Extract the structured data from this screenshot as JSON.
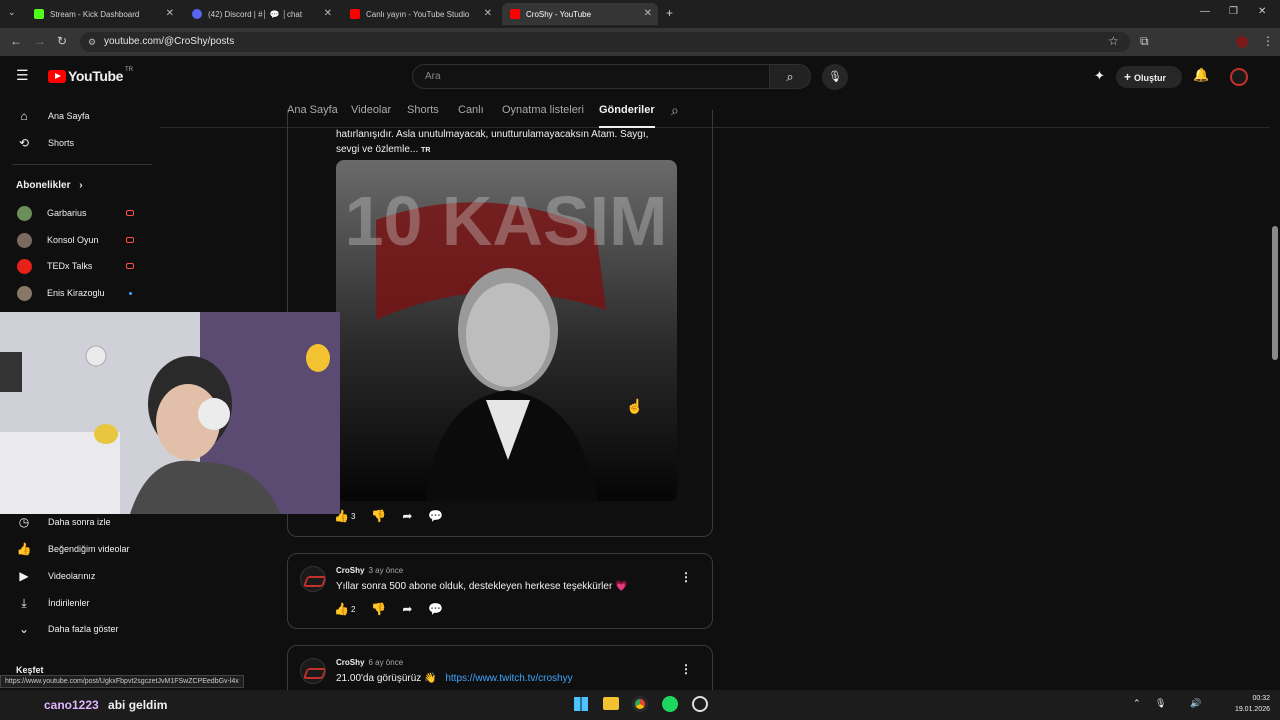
{
  "browser": {
    "tabs": [
      {
        "title": "Stream - Kick Dashboard",
        "color": "#53fc18"
      },
      {
        "title": "(42) Discord | #│ 💬 │chat | …",
        "color": "#5865f2"
      },
      {
        "title": "Canlı yayın - YouTube Studio",
        "color": "#ff0000"
      },
      {
        "title": "CroShy - YouTube",
        "color": "#ff0000"
      }
    ],
    "url": "youtube.com/@CroShy/posts"
  },
  "header": {
    "logo": "YouTube",
    "region": "TR",
    "search_placeholder": "Ara",
    "create_label": "Oluştur"
  },
  "sidebar": {
    "top": [
      {
        "label": "Ana Sayfa",
        "icon": "home-icon"
      },
      {
        "label": "Shorts",
        "icon": "shorts-icon"
      }
    ],
    "subs_header": "Abonelikler",
    "subs": [
      {
        "label": "Garbarius",
        "color": "#6b8f5a",
        "live": true
      },
      {
        "label": "Konsol Oyun",
        "color": "#7a6a60",
        "live": true
      },
      {
        "label": "TEDx Talks",
        "color": "#e62117",
        "live": true
      },
      {
        "label": "Enis Kirazoglu",
        "color": "#887766",
        "live": false
      }
    ],
    "you": [
      {
        "label": "Daha sonra izle",
        "icon": "clock-icon"
      },
      {
        "label": "Beğendiğim videolar",
        "icon": "thumbs-up-icon"
      },
      {
        "label": "Videolarınız",
        "icon": "video-icon"
      },
      {
        "label": "İndirilenler",
        "icon": "download-icon"
      },
      {
        "label": "Daha fazla göster",
        "icon": "chevron-down-icon"
      }
    ],
    "explore_header": "Keşfet"
  },
  "channel_tabs": [
    "Ana Sayfa",
    "Videolar",
    "Shorts",
    "Canlı",
    "Oynatma listeleri",
    "Gönderiler"
  ],
  "selected_tab": "Gönderiler",
  "posts": [
    {
      "text_line1": "hatırlanışıdır. Asla unutulmayacak, unutturulamayacaksın Atam. Saygı,",
      "text_line2": "sevgi ve özlemle...",
      "lang": "TR",
      "image_caption": "10 KASIM",
      "likes": "3"
    },
    {
      "author": "CroShy",
      "ago": "3 ay önce",
      "text": "Yıllar sonra 500 abone olduk, destekleyen herkese teşekkürler 💗",
      "likes": "2"
    },
    {
      "author": "CroShy",
      "ago": "6 ay önce",
      "text": "21.00'da görüşürüz 👋",
      "link": "https://www.twitch.tv/croshyy"
    }
  ],
  "status_url": "https://www.youtube.com/post/UgkxFbpvt2sgczetJvM1FSwZCPEedbGv-l4x",
  "taskbar": {
    "chat_user": "cano1223",
    "chat_msg": "abi geldim",
    "time": "00:32",
    "date": "19.01.2026"
  }
}
